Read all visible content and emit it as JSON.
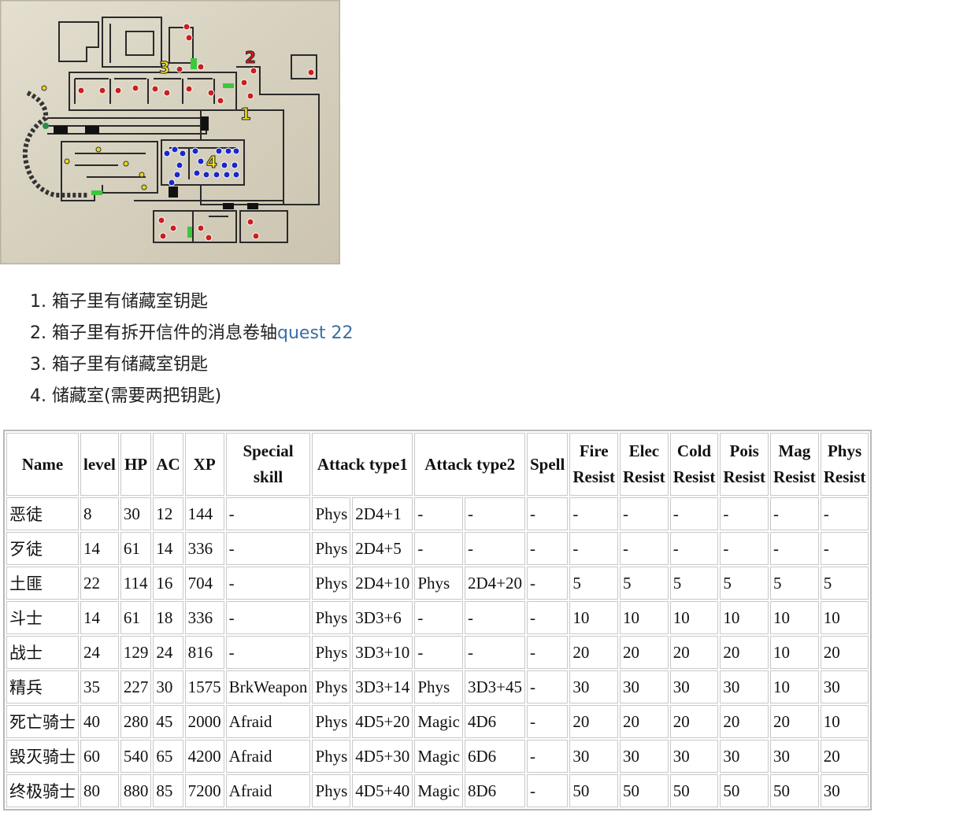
{
  "map": {
    "markers": [
      "1",
      "2",
      "3",
      "4"
    ],
    "colors": {
      "parchment": "#d9d3c2",
      "wall": "#2a2a2a",
      "red_monster": "#c8201e",
      "blue_monster": "#1a28c8",
      "yellow_item": "#e8d81a",
      "door": "#3cc83c",
      "marker_yellow": "#f0e020",
      "marker_red": "#e01818"
    }
  },
  "notes": [
    {
      "number": "1.",
      "text": "箱子里有储藏室钥匙"
    },
    {
      "number": "2.",
      "text": "箱子里有拆开信件的消息卷轴",
      "link": "quest 22"
    },
    {
      "number": "3.",
      "text": "箱子里有储藏室钥匙"
    },
    {
      "number": "4.",
      "text": "储藏室(需要两把钥匙)"
    }
  ],
  "table": {
    "headers": {
      "name": "Name",
      "level": "level",
      "hp": "HP",
      "ac": "AC",
      "xp": "XP",
      "special_1": "Special",
      "special_2": "skill",
      "attack1": "Attack type1",
      "attack2": "Attack type2",
      "spell": "Spell",
      "fire_1": "Fire",
      "fire_2": "Resist",
      "elec_1": "Elec",
      "elec_2": "Resist",
      "cold_1": "Cold",
      "cold_2": "Resist",
      "pois_1": "Pois",
      "pois_2": "Resist",
      "mag_1": "Mag",
      "mag_2": "Resist",
      "phys_1": "Phys",
      "phys_2": "Resist"
    },
    "rows": [
      [
        "恶徒",
        "8",
        "30",
        "12",
        "144",
        "-",
        "Phys",
        "2D4+1",
        "-",
        "-",
        "-",
        "-",
        "-",
        "-",
        "-",
        "-",
        "-"
      ],
      [
        "歹徒",
        "14",
        "61",
        "14",
        "336",
        "-",
        "Phys",
        "2D4+5",
        "-",
        "-",
        "-",
        "-",
        "-",
        "-",
        "-",
        "-",
        "-"
      ],
      [
        "土匪",
        "22",
        "114",
        "16",
        "704",
        "-",
        "Phys",
        "2D4+10",
        "Phys",
        "2D4+20",
        "-",
        "5",
        "5",
        "5",
        "5",
        "5",
        "5"
      ],
      [
        "斗士",
        "14",
        "61",
        "18",
        "336",
        "-",
        "Phys",
        "3D3+6",
        "-",
        "-",
        "-",
        "10",
        "10",
        "10",
        "10",
        "10",
        "10"
      ],
      [
        "战士",
        "24",
        "129",
        "24",
        "816",
        "-",
        "Phys",
        "3D3+10",
        "-",
        "-",
        "-",
        "20",
        "20",
        "20",
        "20",
        "10",
        "20"
      ],
      [
        "精兵",
        "35",
        "227",
        "30",
        "1575",
        "BrkWeapon",
        "Phys",
        "3D3+14",
        "Phys",
        "3D3+45",
        "-",
        "30",
        "30",
        "30",
        "30",
        "10",
        "30"
      ],
      [
        "死亡骑士",
        "40",
        "280",
        "45",
        "2000",
        "Afraid",
        "Phys",
        "4D5+20",
        "Magic",
        "4D6",
        "-",
        "20",
        "20",
        "20",
        "20",
        "20",
        "10"
      ],
      [
        "毁灭骑士",
        "60",
        "540",
        "65",
        "4200",
        "Afraid",
        "Phys",
        "4D5+30",
        "Magic",
        "6D6",
        "-",
        "30",
        "30",
        "30",
        "30",
        "30",
        "20"
      ],
      [
        "终极骑士",
        "80",
        "880",
        "85",
        "7200",
        "Afraid",
        "Phys",
        "4D5+40",
        "Magic",
        "8D6",
        "-",
        "50",
        "50",
        "50",
        "50",
        "50",
        "30"
      ]
    ]
  }
}
